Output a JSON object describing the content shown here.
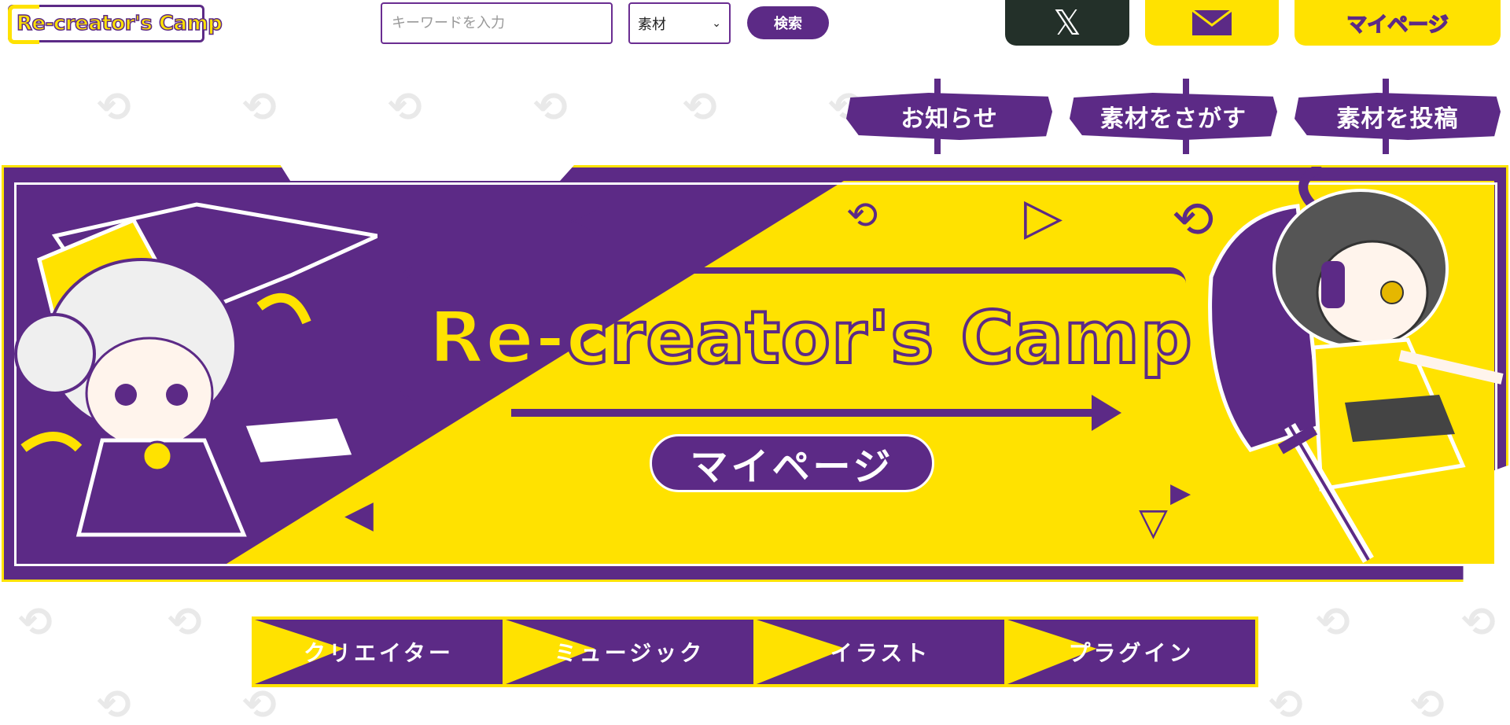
{
  "header": {
    "logo_text": "Re-creator's Camp",
    "search": {
      "placeholder": "キーワードを入力",
      "value": ""
    },
    "category_select": {
      "selected": "素材",
      "chevron": "⌄"
    },
    "search_button": "検索",
    "x_button": "𝕏",
    "mail_icon": "mail-icon",
    "mypage_button": "マイページ"
  },
  "nav": {
    "items": [
      {
        "label": "お知らせ"
      },
      {
        "label": "素材をさがす"
      },
      {
        "label": "素材を投稿"
      }
    ]
  },
  "hero": {
    "title": "Re-creator's Camp",
    "mypage_button": "マイページ"
  },
  "categories": [
    {
      "label": "クリエイター"
    },
    {
      "label": "ミュージック"
    },
    {
      "label": "イラスト"
    },
    {
      "label": "プラグイン"
    }
  ],
  "colors": {
    "purple": "#5c2a86",
    "yellow": "#ffe200",
    "dark": "#233029",
    "white": "#ffffff"
  }
}
